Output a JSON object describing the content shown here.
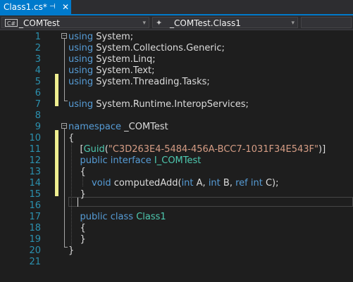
{
  "tab": {
    "title": "Class1.cs*",
    "pin_glyph": "⊣",
    "close_glyph": "✕"
  },
  "nav": {
    "project_icon_text": "C#",
    "project": "_COMTest",
    "member": "_COMTest.Class1",
    "dropdown_glyph": "▾",
    "member_icon_glyph": "✦"
  },
  "editor": {
    "line_numbers": [
      "1",
      "2",
      "3",
      "4",
      "5",
      "6",
      "7",
      "8",
      "9",
      "10",
      "11",
      "12",
      "13",
      "14",
      "15",
      "16",
      "17",
      "18",
      "19",
      "20",
      "21"
    ],
    "lines": [
      [
        {
          "c": "kw",
          "t": "using"
        },
        {
          "c": "pl",
          "t": " System;"
        }
      ],
      [
        {
          "c": "kw",
          "t": "using"
        },
        {
          "c": "pl",
          "t": " System.Collections.Generic;"
        }
      ],
      [
        {
          "c": "kw",
          "t": "using"
        },
        {
          "c": "pl",
          "t": " System.Linq;"
        }
      ],
      [
        {
          "c": "kw",
          "t": "using"
        },
        {
          "c": "pl",
          "t": " System.Text;"
        }
      ],
      [
        {
          "c": "kw",
          "t": "using"
        },
        {
          "c": "pl",
          "t": " System.Threading.Tasks;"
        }
      ],
      [],
      [
        {
          "c": "kw",
          "t": "using"
        },
        {
          "c": "pl",
          "t": " System.Runtime.InteropServices;"
        }
      ],
      [],
      [
        {
          "c": "kw",
          "t": "namespace"
        },
        {
          "c": "pl",
          "t": " _COMTest"
        }
      ],
      [
        {
          "c": "pl",
          "t": "{"
        }
      ],
      [
        {
          "c": "pl",
          "t": "    ["
        },
        {
          "c": "ty",
          "t": "Guid"
        },
        {
          "c": "pl",
          "t": "("
        },
        {
          "c": "st",
          "t": "\"C3D263E4-5484-456A-BCC7-1031F34E543F\""
        },
        {
          "c": "pl",
          "t": ")]"
        }
      ],
      [
        {
          "c": "kw",
          "t": "    public interface"
        },
        {
          "c": "pl",
          "t": " "
        },
        {
          "c": "ty",
          "t": "I_COMTest"
        }
      ],
      [
        {
          "c": "pl",
          "t": "    {"
        }
      ],
      [
        {
          "c": "kw",
          "t": "        void"
        },
        {
          "c": "pl",
          "t": " computedAdd("
        },
        {
          "c": "kw",
          "t": "int"
        },
        {
          "c": "pl",
          "t": " A, "
        },
        {
          "c": "kw",
          "t": "int"
        },
        {
          "c": "pl",
          "t": " B, "
        },
        {
          "c": "kw",
          "t": "ref int"
        },
        {
          "c": "pl",
          "t": " C);"
        }
      ],
      [
        {
          "c": "pl",
          "t": "    }"
        }
      ],
      [],
      [
        {
          "c": "kw",
          "t": "    public class"
        },
        {
          "c": "pl",
          "t": " "
        },
        {
          "c": "ty",
          "t": "Class1"
        }
      ],
      [
        {
          "c": "pl",
          "t": "    {"
        }
      ],
      [
        {
          "c": "pl",
          "t": "    }"
        }
      ],
      [
        {
          "c": "pl",
          "t": "}"
        }
      ],
      []
    ]
  },
  "colors": {
    "tab_active": "#007acc",
    "line_number": "#2b91af",
    "keyword": "#569cd6",
    "type": "#4ec9b0",
    "string": "#d69d85",
    "change_marker": "#efef91"
  }
}
